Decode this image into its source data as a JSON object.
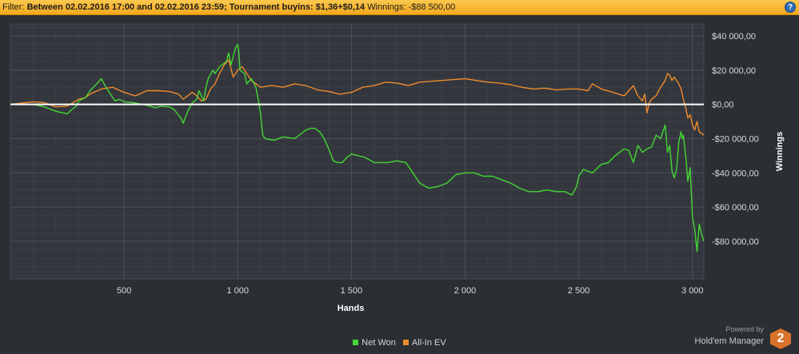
{
  "filter": {
    "prefix": "Filter: ",
    "between": "Between 02.02.2016 17:00 and 02.02.2016 23:59; Tournament buyins: $1,36+$0,14",
    "winnings": " Winnings: -$88 500,00",
    "help_icon": "help-icon"
  },
  "chart_data": {
    "type": "line",
    "xlabel": "Hands",
    "ylabel": "Winnings",
    "xlim": [
      0,
      3050
    ],
    "ylim": [
      -102000,
      47000
    ],
    "x_ticks": [
      500,
      1000,
      1500,
      2000,
      2500,
      3000
    ],
    "x_tick_labels": [
      "500",
      "1 000",
      "1 500",
      "2 000",
      "2 500",
      "3 000"
    ],
    "y_ticks": [
      40000,
      20000,
      0,
      -20000,
      -40000,
      -60000,
      -80000
    ],
    "y_tick_labels": [
      "$40 000,00",
      "$20 000,00",
      "$0,00",
      "-$20 000,00",
      "-$40 000,00",
      "-$60 000,00",
      "-$80 000,00"
    ],
    "grid": true,
    "legend_position": "bottom",
    "series": [
      {
        "name": "Net Won",
        "color": "#43d833",
        "points": [
          [
            0,
            0
          ],
          [
            80,
            0
          ],
          [
            100,
            0
          ],
          [
            150,
            -1500
          ],
          [
            200,
            -4000
          ],
          [
            250,
            -5500
          ],
          [
            270,
            -3000
          ],
          [
            290,
            -1000
          ],
          [
            300,
            2000
          ],
          [
            330,
            4000
          ],
          [
            350,
            8000
          ],
          [
            380,
            12000
          ],
          [
            400,
            15000
          ],
          [
            420,
            10000
          ],
          [
            440,
            6000
          ],
          [
            460,
            2000
          ],
          [
            480,
            3000
          ],
          [
            500,
            1500
          ],
          [
            540,
            1000
          ],
          [
            580,
            0
          ],
          [
            600,
            -500
          ],
          [
            640,
            -2000
          ],
          [
            660,
            -1000
          ],
          [
            700,
            -1500
          ],
          [
            720,
            -3000
          ],
          [
            750,
            -8000
          ],
          [
            760,
            -11000
          ],
          [
            780,
            -4000
          ],
          [
            800,
            1000
          ],
          [
            820,
            3000
          ],
          [
            830,
            8000
          ],
          [
            850,
            2000
          ],
          [
            860,
            10000
          ],
          [
            870,
            15000
          ],
          [
            890,
            20000
          ],
          [
            900,
            18000
          ],
          [
            920,
            22000
          ],
          [
            950,
            25000
          ],
          [
            960,
            30000
          ],
          [
            970,
            23000
          ],
          [
            980,
            28000
          ],
          [
            990,
            33000
          ],
          [
            1000,
            35000
          ],
          [
            1005,
            30000
          ],
          [
            1010,
            20000
          ],
          [
            1030,
            18000
          ],
          [
            1040,
            12000
          ],
          [
            1060,
            15000
          ],
          [
            1080,
            10000
          ],
          [
            1090,
            3000
          ],
          [
            1100,
            -5000
          ],
          [
            1110,
            -18000
          ],
          [
            1120,
            -20000
          ],
          [
            1160,
            -21000
          ],
          [
            1200,
            -19000
          ],
          [
            1250,
            -20000
          ],
          [
            1280,
            -17000
          ],
          [
            1300,
            -15000
          ],
          [
            1320,
            -14000
          ],
          [
            1340,
            -14000
          ],
          [
            1360,
            -16000
          ],
          [
            1380,
            -20000
          ],
          [
            1400,
            -26000
          ],
          [
            1420,
            -33000
          ],
          [
            1440,
            -34000
          ],
          [
            1460,
            -34000
          ],
          [
            1480,
            -31000
          ],
          [
            1500,
            -29000
          ],
          [
            1530,
            -30000
          ],
          [
            1560,
            -31000
          ],
          [
            1600,
            -34000
          ],
          [
            1630,
            -34000
          ],
          [
            1660,
            -34000
          ],
          [
            1700,
            -33000
          ],
          [
            1740,
            -34000
          ],
          [
            1760,
            -38000
          ],
          [
            1800,
            -46000
          ],
          [
            1840,
            -49000
          ],
          [
            1880,
            -48000
          ],
          [
            1920,
            -46000
          ],
          [
            1960,
            -41000
          ],
          [
            2000,
            -40000
          ],
          [
            2040,
            -40000
          ],
          [
            2080,
            -42000
          ],
          [
            2120,
            -42000
          ],
          [
            2160,
            -44000
          ],
          [
            2200,
            -46000
          ],
          [
            2240,
            -49000
          ],
          [
            2280,
            -51000
          ],
          [
            2320,
            -51000
          ],
          [
            2360,
            -50000
          ],
          [
            2400,
            -51000
          ],
          [
            2440,
            -51000
          ],
          [
            2470,
            -53000
          ],
          [
            2490,
            -48000
          ],
          [
            2500,
            -42000
          ],
          [
            2520,
            -38000
          ],
          [
            2560,
            -40000
          ],
          [
            2600,
            -35000
          ],
          [
            2630,
            -34000
          ],
          [
            2660,
            -30000
          ],
          [
            2680,
            -28000
          ],
          [
            2700,
            -26000
          ],
          [
            2720,
            -27000
          ],
          [
            2740,
            -34000
          ],
          [
            2760,
            -24000
          ],
          [
            2780,
            -28000
          ],
          [
            2800,
            -26000
          ],
          [
            2820,
            -25000
          ],
          [
            2840,
            -18000
          ],
          [
            2860,
            -20000
          ],
          [
            2880,
            -12000
          ],
          [
            2890,
            -28000
          ],
          [
            2900,
            -24000
          ],
          [
            2910,
            -39000
          ],
          [
            2920,
            -43000
          ],
          [
            2930,
            -38000
          ],
          [
            2940,
            -22000
          ],
          [
            2950,
            -16000
          ],
          [
            2955,
            -20000
          ],
          [
            2960,
            -18000
          ],
          [
            2970,
            -30000
          ],
          [
            2980,
            -45000
          ],
          [
            2990,
            -37000
          ],
          [
            3000,
            -66000
          ],
          [
            3010,
            -73000
          ],
          [
            3020,
            -86000
          ],
          [
            3030,
            -70000
          ],
          [
            3040,
            -76000
          ],
          [
            3050,
            -80000
          ]
        ]
      },
      {
        "name": "All-In EV",
        "color": "#f08a2b",
        "points": [
          [
            0,
            0
          ],
          [
            100,
            1500
          ],
          [
            150,
            1000
          ],
          [
            200,
            -1500
          ],
          [
            250,
            -1000
          ],
          [
            300,
            3000
          ],
          [
            330,
            4000
          ],
          [
            350,
            6000
          ],
          [
            400,
            9000
          ],
          [
            450,
            10000
          ],
          [
            500,
            7000
          ],
          [
            550,
            5000
          ],
          [
            600,
            8000
          ],
          [
            650,
            8000
          ],
          [
            700,
            7500
          ],
          [
            740,
            6000
          ],
          [
            760,
            3000
          ],
          [
            800,
            7000
          ],
          [
            820,
            5000
          ],
          [
            840,
            2000
          ],
          [
            860,
            3000
          ],
          [
            880,
            9000
          ],
          [
            900,
            12000
          ],
          [
            920,
            18000
          ],
          [
            940,
            23000
          ],
          [
            960,
            26000
          ],
          [
            980,
            16000
          ],
          [
            1000,
            20000
          ],
          [
            1020,
            22000
          ],
          [
            1040,
            18000
          ],
          [
            1060,
            14000
          ],
          [
            1080,
            12000
          ],
          [
            1100,
            10000
          ],
          [
            1150,
            11000
          ],
          [
            1200,
            10000
          ],
          [
            1250,
            12000
          ],
          [
            1300,
            11000
          ],
          [
            1350,
            8500
          ],
          [
            1400,
            7500
          ],
          [
            1450,
            6000
          ],
          [
            1500,
            7000
          ],
          [
            1550,
            10000
          ],
          [
            1600,
            11000
          ],
          [
            1650,
            13000
          ],
          [
            1700,
            12500
          ],
          [
            1750,
            11000
          ],
          [
            1800,
            13000
          ],
          [
            1850,
            13500
          ],
          [
            1900,
            14000
          ],
          [
            1950,
            14500
          ],
          [
            2000,
            15000
          ],
          [
            2050,
            14000
          ],
          [
            2100,
            13000
          ],
          [
            2150,
            12500
          ],
          [
            2200,
            11500
          ],
          [
            2250,
            10000
          ],
          [
            2300,
            9000
          ],
          [
            2350,
            9500
          ],
          [
            2400,
            8500
          ],
          [
            2450,
            9000
          ],
          [
            2500,
            9000
          ],
          [
            2540,
            8000
          ],
          [
            2560,
            12000
          ],
          [
            2600,
            9000
          ],
          [
            2650,
            7000
          ],
          [
            2700,
            5000
          ],
          [
            2720,
            8000
          ],
          [
            2740,
            11000
          ],
          [
            2760,
            5000
          ],
          [
            2780,
            2000
          ],
          [
            2790,
            6000
          ],
          [
            2800,
            -5000
          ],
          [
            2810,
            1000
          ],
          [
            2820,
            3000
          ],
          [
            2840,
            5000
          ],
          [
            2860,
            10000
          ],
          [
            2880,
            14000
          ],
          [
            2890,
            18000
          ],
          [
            2900,
            17000
          ],
          [
            2910,
            14000
          ],
          [
            2920,
            16000
          ],
          [
            2940,
            12000
          ],
          [
            2950,
            9000
          ],
          [
            2960,
            3000
          ],
          [
            2970,
            -2000
          ],
          [
            2980,
            -8000
          ],
          [
            2990,
            -6000
          ],
          [
            3000,
            -12000
          ],
          [
            3010,
            -15000
          ],
          [
            3020,
            -10000
          ],
          [
            3030,
            -16000
          ],
          [
            3040,
            -17000
          ],
          [
            3050,
            -18000
          ]
        ]
      }
    ]
  },
  "legend": {
    "items": [
      {
        "label": "Net Won",
        "color": "#43d833"
      },
      {
        "label": "All-In EV",
        "color": "#f08a2b"
      }
    ]
  },
  "branding": {
    "powered_by": "Powered by",
    "product": "Hold'em Manager",
    "badge": "2"
  }
}
